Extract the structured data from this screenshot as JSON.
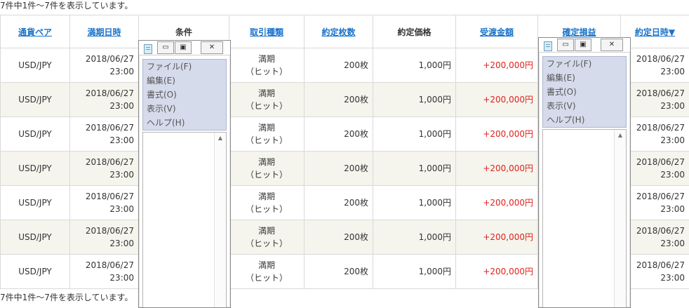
{
  "summary_top": "7件中1件～7件を表示しています。",
  "summary_bottom": "7件中1件～7件を表示しています。",
  "columns": [
    {
      "label": "通貨ペア",
      "link": true
    },
    {
      "label": "満期日時",
      "link": true
    },
    {
      "label": "条件",
      "link": false
    },
    {
      "label": "取引種類",
      "link": true
    },
    {
      "label": "約定枚数",
      "link": true
    },
    {
      "label": "約定価格",
      "link": false
    },
    {
      "label": "受渡金額",
      "link": true
    },
    {
      "label": "確定損益",
      "link": true
    },
    {
      "label": "約定日時▼",
      "link": true
    }
  ],
  "rows": [
    {
      "pair": "USD/JPY",
      "expiry_date": "2018/06/27",
      "expiry_time": "23:00",
      "condition": "",
      "kind_line1": "満期",
      "kind_line2": "（ヒット）",
      "quantity": "200枚",
      "price": "1,000円",
      "amount": "+200,000円",
      "profit": "",
      "trade_date": "2018/06/27",
      "trade_time": "23:00"
    },
    {
      "pair": "USD/JPY",
      "expiry_date": "2018/06/27",
      "expiry_time": "23:00",
      "condition": "",
      "kind_line1": "満期",
      "kind_line2": "（ヒット）",
      "quantity": "200枚",
      "price": "1,000円",
      "amount": "+200,000円",
      "profit": "",
      "trade_date": "2018/06/27",
      "trade_time": "23:00"
    },
    {
      "pair": "USD/JPY",
      "expiry_date": "2018/06/27",
      "expiry_time": "23:00",
      "condition": "",
      "kind_line1": "満期",
      "kind_line2": "（ヒット）",
      "quantity": "200枚",
      "price": "1,000円",
      "amount": "+200,000円",
      "profit": "",
      "trade_date": "2018/06/27",
      "trade_time": "23:00"
    },
    {
      "pair": "USD/JPY",
      "expiry_date": "2018/06/27",
      "expiry_time": "23:00",
      "condition": "",
      "kind_line1": "満期",
      "kind_line2": "（ヒット）",
      "quantity": "200枚",
      "price": "1,000円",
      "amount": "+200,000円",
      "profit": "",
      "trade_date": "2018/06/27",
      "trade_time": "23:00"
    },
    {
      "pair": "USD/JPY",
      "expiry_date": "2018/06/27",
      "expiry_time": "23:00",
      "condition": "",
      "kind_line1": "満期",
      "kind_line2": "（ヒット）",
      "quantity": "200枚",
      "price": "1,000円",
      "amount": "+200,000円",
      "profit": "",
      "trade_date": "2018/06/27",
      "trade_time": "23:00"
    },
    {
      "pair": "USD/JPY",
      "expiry_date": "2018/06/27",
      "expiry_time": "23:00",
      "condition": "",
      "kind_line1": "満期",
      "kind_line2": "（ヒット）",
      "quantity": "200枚",
      "price": "1,000円",
      "amount": "+200,000円",
      "profit": "",
      "trade_date": "2018/06/27",
      "trade_time": "23:00"
    },
    {
      "pair": "USD/JPY",
      "expiry_date": "2018/06/27",
      "expiry_time": "23:00",
      "condition": "",
      "kind_line1": "満期",
      "kind_line2": "（ヒット）",
      "quantity": "200枚",
      "price": "1,000円",
      "amount": "+200,000円",
      "profit": "",
      "trade_date": "2018/06/27",
      "trade_time": "23:00"
    }
  ],
  "notepad": {
    "icon": "notepad-icon",
    "minimize_glyph": "▭",
    "maximize_glyph": "▣",
    "close_glyph": "✕",
    "scroll_up_glyph": "▲",
    "menu": [
      "ファイル(F)",
      "編集(E)",
      "書式(O)",
      "表示(V)",
      "ヘルプ(H)"
    ]
  },
  "colors": {
    "link": "#1a73c9",
    "positive_amount": "#e0201c",
    "alt_row": "#f5f5ee",
    "menu_highlight": "#d6dbec"
  }
}
